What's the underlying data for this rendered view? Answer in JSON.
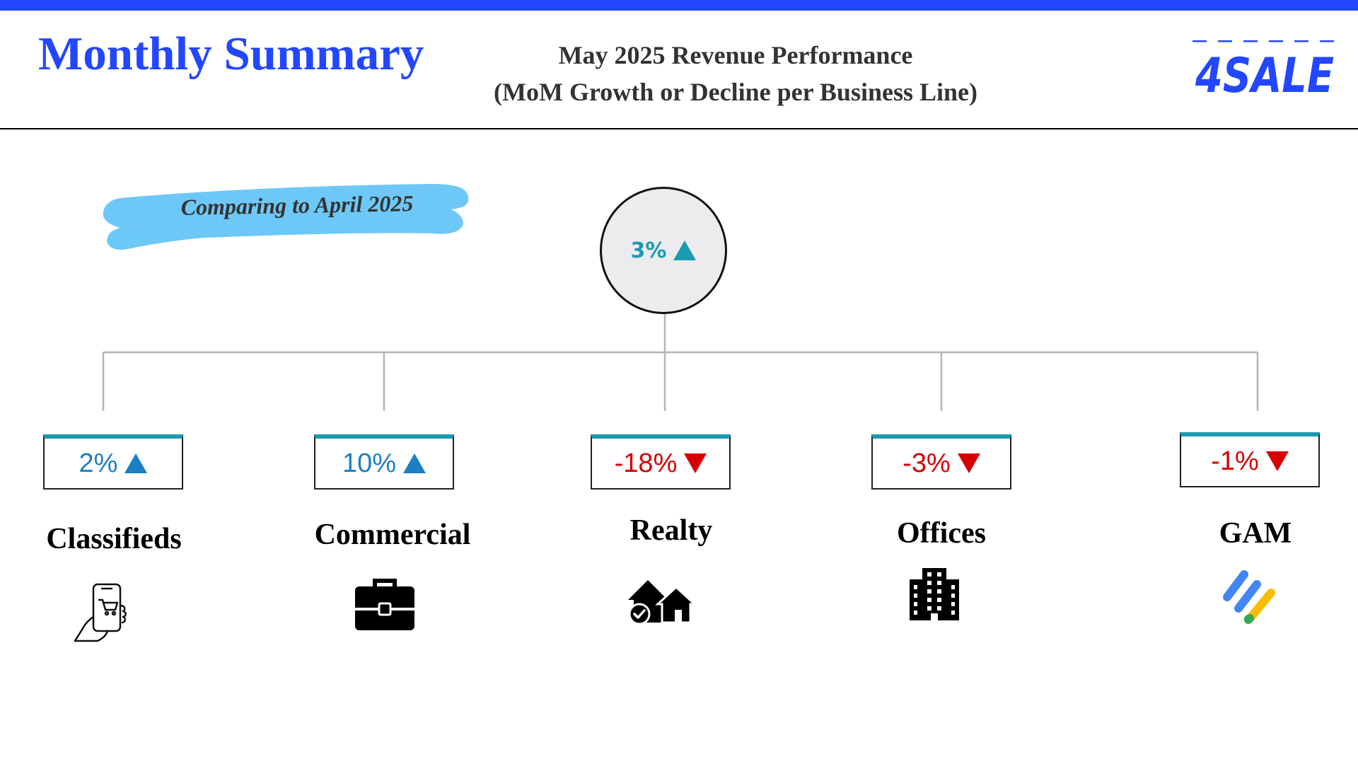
{
  "header": {
    "title": "Monthly Summary",
    "subtitle_line1": "May 2025 Revenue Performance",
    "subtitle_line2": "(MoM Growth or Decline per Business Line)",
    "logo_text": "4SALE"
  },
  "comparison_note": "Comparing to April 2025",
  "total": {
    "value": "3%",
    "direction": "up",
    "color": "#1a9bb3"
  },
  "business_lines": [
    {
      "label": "Classifieds",
      "value": "2%",
      "direction": "up",
      "color": "#1b7fc4",
      "icon": "smartphone-shopping-cart-icon"
    },
    {
      "label": "Commercial",
      "value": "10%",
      "direction": "up",
      "color": "#1b7fc4",
      "icon": "briefcase-icon"
    },
    {
      "label": "Realty",
      "value": "-18%",
      "direction": "down",
      "color": "#d60000",
      "icon": "houses-check-icon"
    },
    {
      "label": "Offices",
      "value": "-3%",
      "direction": "down",
      "color": "#d60000",
      "icon": "office-building-icon"
    },
    {
      "label": "GAM",
      "value": "-1%",
      "direction": "down",
      "color": "#d60000",
      "icon": "google-ad-manager-icon"
    }
  ],
  "colors": {
    "brand": "#2347ff",
    "node_top_border": "#1a9bb3",
    "up": "#1b7fc4",
    "down": "#d60000",
    "brush": "#6ec8f7"
  }
}
